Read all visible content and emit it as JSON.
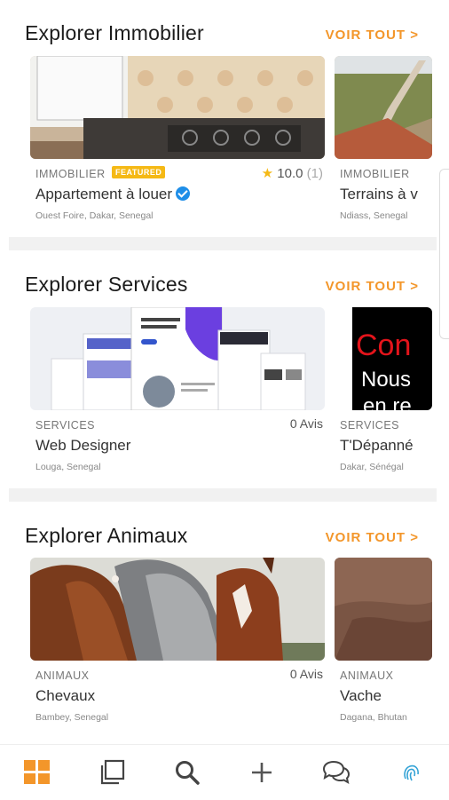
{
  "sections": [
    {
      "title": "Explorer Immobilier",
      "see_all": "VOIR TOUT >",
      "cards": [
        {
          "category": "IMMOBILIER",
          "badge": "FEATURED",
          "title": "Appartement à louer",
          "location": "Ouest Foire, Dakar, Senegal",
          "rating": "10.0",
          "rating_count": "(1)"
        },
        {
          "category": "IMMOBILIER",
          "title": "Terrains à v",
          "location": "Ndiass, Senegal"
        }
      ]
    },
    {
      "title": "Explorer Services",
      "see_all": "VOIR TOUT >",
      "cards": [
        {
          "category": "SERVICES",
          "title": "Web Designer",
          "location": "Louga, Senegal",
          "reviews": "0 Avis"
        },
        {
          "category": "SERVICES",
          "title": "T'Dépanné",
          "location": "Dakar, Sénégal",
          "img_text_1": "Con",
          "img_text_2": "Nous",
          "img_text_3": "en re"
        }
      ]
    },
    {
      "title": "Explorer Animaux",
      "see_all": "VOIR TOUT >",
      "cards": [
        {
          "category": "ANIMAUX",
          "title": "Chevaux",
          "location": "Bambey, Senegal",
          "reviews": "0 Avis"
        },
        {
          "category": "ANIMAUX",
          "title": "Vache",
          "location": "Dagana, Bhutan"
        }
      ]
    }
  ],
  "colors": {
    "accent": "#f3962a",
    "badge": "#f5b915",
    "verified": "#1e8ee8",
    "star": "#f5b915"
  },
  "nav": [
    "grid-icon",
    "copy-icon",
    "search-icon",
    "plus-icon",
    "chat-icon",
    "fingerprint-icon"
  ]
}
